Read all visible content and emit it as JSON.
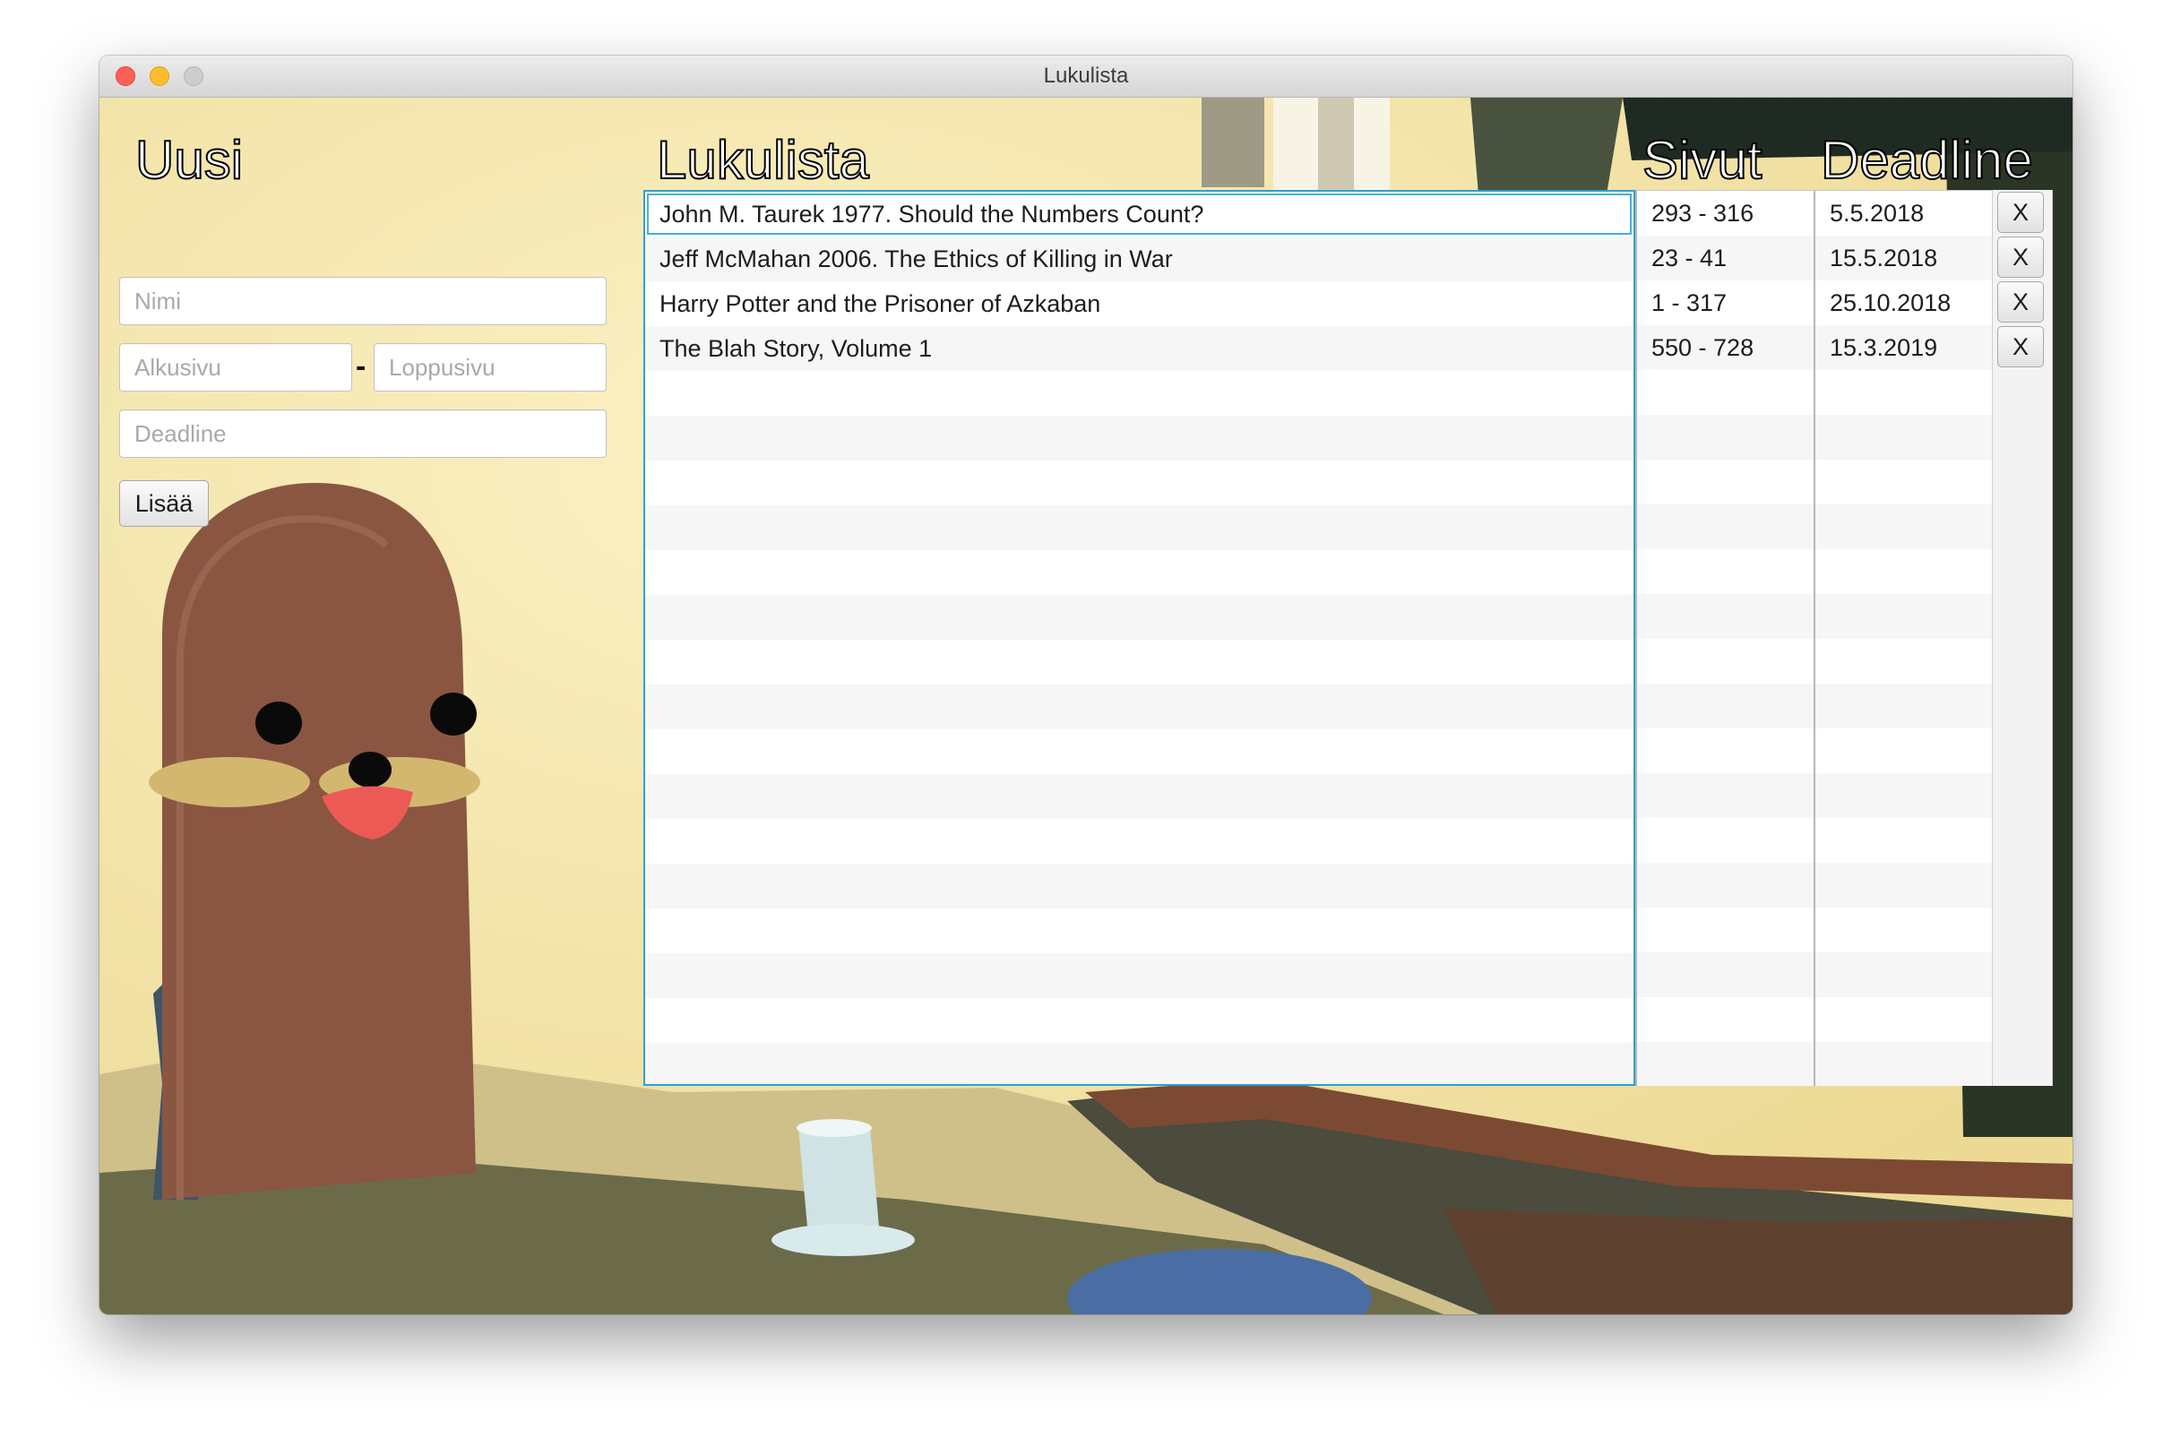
{
  "window": {
    "title": "Lukulista"
  },
  "new_form": {
    "heading": "Uusi",
    "name_placeholder": "Nimi",
    "start_page_placeholder": "Alkusivu",
    "separator": "-",
    "end_page_placeholder": "Loppusivu",
    "deadline_placeholder": "Deadline",
    "add_button": "Lisää"
  },
  "reading_list": {
    "heading": "Lukulista",
    "pages_heading": "Sivut",
    "deadline_heading": "Deadline",
    "delete_label": "X",
    "items": [
      {
        "title": "John M. Taurek 1977. Should the Numbers Count?",
        "pages": "293 - 316",
        "deadline": "5.5.2018"
      },
      {
        "title": "Jeff McMahan 2006. The Ethics of Killing in War",
        "pages": "23 - 41",
        "deadline": "15.5.2018"
      },
      {
        "title": "Harry Potter and the Prisoner of Azkaban",
        "pages": "1 - 317",
        "deadline": "25.10.2018"
      },
      {
        "title": "The Blah Story, Volume 1",
        "pages": "550 - 728",
        "deadline": "15.3.2019"
      }
    ]
  },
  "colors": {
    "selection_border": "#2f9fd4",
    "background_wall": "#f3e6a6",
    "figure_brown": "#8a5642"
  },
  "icons": {
    "close": "close-window-icon",
    "minimize": "minimize-window-icon",
    "zoom": "zoom-window-icon",
    "background": "background-painting-icon"
  }
}
